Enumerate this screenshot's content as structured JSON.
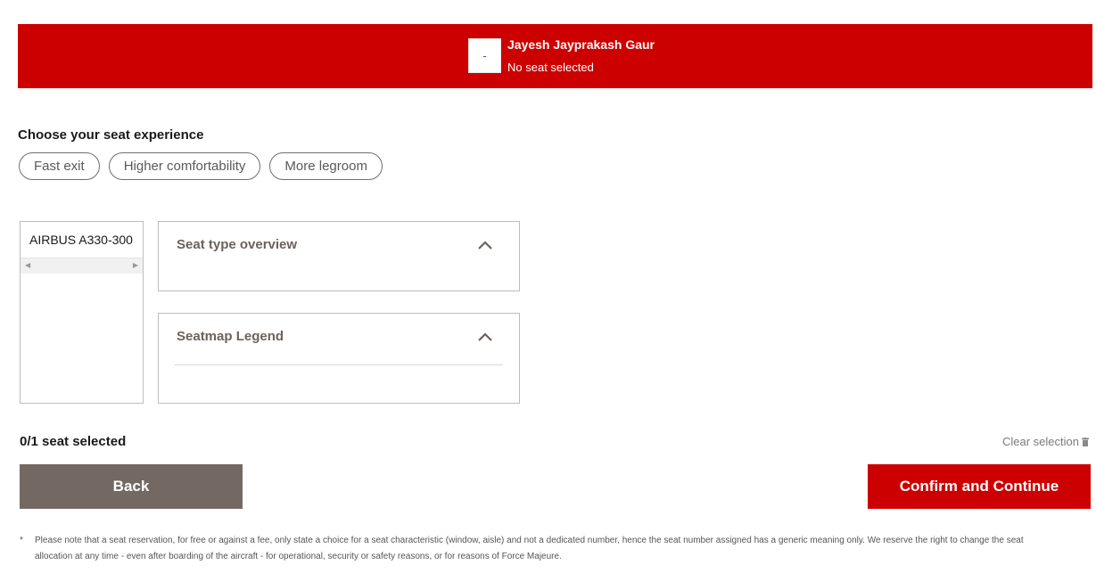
{
  "passenger": {
    "seat_placeholder": "-",
    "name": "Jayesh Jayprakash Gaur",
    "status": "No seat selected"
  },
  "experience": {
    "title": "Choose your seat experience",
    "chips": [
      "Fast exit",
      "Higher comfortability",
      "More legroom"
    ]
  },
  "aircraft": {
    "name": "AIRBUS A330-300",
    "scroll_left": "◀",
    "scroll_right": "▶"
  },
  "panels": {
    "seat_type_title": "Seat type overview",
    "legend_title": "Seatmap Legend"
  },
  "selection": {
    "count": "0/1 seat selected",
    "clear_label": "Clear selection"
  },
  "actions": {
    "back_label": "Back",
    "confirm_label": "Confirm and Continue"
  },
  "footnote": {
    "star": "*",
    "text": "Please note that a seat reservation, for free or against a fee, only state a choice for a seat characteristic (window, aisle) and not a dedicated number, hence the seat number assigned has a generic meaning only. We reserve the right to change the seat allocation at any time - even after boarding of the aircraft - for operational, security or safety reasons, or for reasons of Force Majeure."
  },
  "colors": {
    "brand_red": "#cc0000",
    "back_button": "#736962",
    "panel_title": "#6b625c"
  },
  "icons": {
    "chevron": "chevron-up-icon",
    "trash": "trash-icon"
  }
}
